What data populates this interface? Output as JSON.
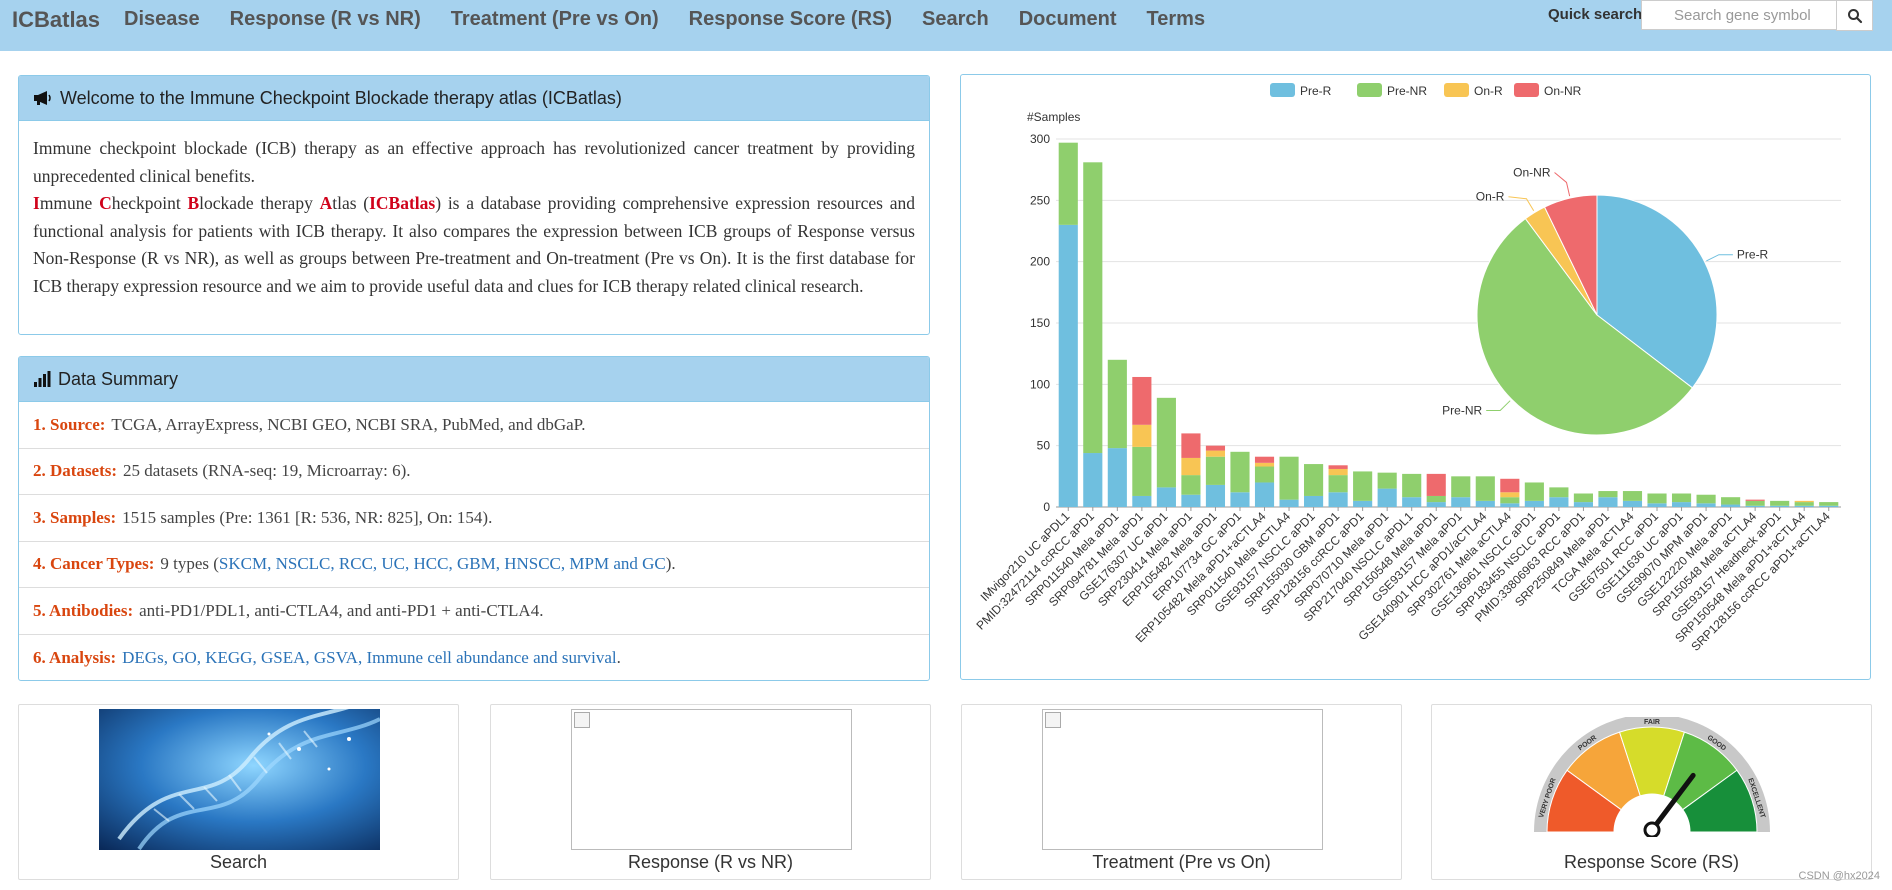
{
  "navbar": {
    "brand": "ICBatlas",
    "items": [
      {
        "label": "Disease"
      },
      {
        "label": "Response (R vs NR)"
      },
      {
        "label": "Treatment (Pre vs On)"
      },
      {
        "label": "Response Score (RS)"
      },
      {
        "label": "Search"
      },
      {
        "label": "Document"
      },
      {
        "label": "Terms"
      }
    ],
    "quick_search_label": "Quick search",
    "search_placeholder": "Search gene symbol",
    "search_button_icon": "search-icon"
  },
  "welcome": {
    "icon": "megaphone-icon",
    "title": "Welcome to the Immune Checkpoint Blockade therapy atlas (ICBatlas)",
    "para1": "Immune checkpoint blockade (ICB) therapy as an effective approach has revolutionized cancer treatment by providing unprecedented clinical benefits.",
    "acr": [
      {
        "letter": "I",
        "rest": "mmune "
      },
      {
        "letter": "C",
        "rest": "heckpoint "
      },
      {
        "letter": "B",
        "rest": "lockade therapy "
      },
      {
        "letter": "A",
        "rest": "tlas ("
      }
    ],
    "acr_name": "ICBatlas",
    "para2_rest": ") is a database providing comprehensive expression resources and functional analysis for patients with ICB therapy. It also compares the expression between ICB groups of Response versus Non-Response (R vs NR), as well as groups between Pre-treatment and On-treatment (Pre vs On). It is the first database for ICB therapy expression resource and we aim to provide useful data and clues for ICB therapy related clinical research."
  },
  "summary": {
    "icon": "bar-chart-icon",
    "title": "Data Summary",
    "rows": [
      {
        "label": "1. Source:",
        "text": "TCGA, ArrayExpress, NCBI GEO, NCBI SRA, PubMed, and dbGaP.",
        "suffix": ""
      },
      {
        "label": "2. Datasets:",
        "text": "25 datasets (RNA-seq: 19, Microarray: 6).",
        "suffix": ""
      },
      {
        "label": "3. Samples:",
        "text": "1515 samples (Pre: 1361 [R: 536, NR: 825], On: 154).",
        "suffix": ""
      },
      {
        "label": "4. Cancer Types:",
        "text": "9 types (",
        "link": "SKCM, NSCLC, RCC, UC, HCC, GBM, HNSCC, MPM and GC",
        "suffix": ")."
      },
      {
        "label": "5. Antibodies:",
        "text": "anti-PD1/PDL1, anti-CTLA4, and anti-PD1 + anti-CTLA4.",
        "suffix": ""
      },
      {
        "label": "6. Analysis:",
        "text": "",
        "link": "DEGs, GO, KEGG, GSEA, GSVA, Immune cell abundance and survival",
        "suffix": "."
      }
    ]
  },
  "chart_data": [
    {
      "type": "bar",
      "stacked": true,
      "ylabel": "#Samples",
      "ylim": [
        0,
        300
      ],
      "yticks": [
        0,
        50,
        100,
        150,
        200,
        250,
        300
      ],
      "grid": true,
      "legend_position": "top-center",
      "categories": [
        "IMvigor210 UC aPDL1",
        "PMID:32472114 ccRCC aPD1",
        "SRP011540 Mela aPD1",
        "SRP094781 Mela aPD1",
        "GSE176307 UC aPD1",
        "SRP230414 Mela aPD1",
        "ERP105482 Mela aPD1",
        "ERP107734 GC aPD1",
        "ERP105482 Mela aPD1+aCTLA4",
        "SRP011540 Mela aCTLA4",
        "GSE93157 NSCLC aPD1",
        "SRP155030 GBM aPD1",
        "SRP128156 ccRCC aPD1",
        "SRP070710 Mela aPD1",
        "SRP217040 NSCLC aPDL1",
        "SRP150548 Mela aPD1",
        "GSE93157 Mela aPD1",
        "GSE140901 HCC aPD1/aCTLA4",
        "SRP302761 Mela aCTLA4",
        "GSE136961 NSCLC aPD1",
        "SRP183455 NSCLC aPD1",
        "PMID:33806963 RCC aPD1",
        "SRP250849 Mela aPD1",
        "TCGA Mela aCTLA4",
        "GSE67501 RCC aPD1",
        "GSE111636 UC aPD1",
        "GSE99070 MPM aPD1",
        "GSE122220 Mela aPD1",
        "SRP150548 Mela aCTLA4",
        "GSE93157 Headneck aPD1",
        "SRP150548 Mela aPD1+aCTLA4",
        "SRP128156 ccRCC aPD1+aCTLA4"
      ],
      "series": [
        {
          "name": "Pre-R",
          "color": "#6fbfdf",
          "values": [
            230,
            44,
            48,
            9,
            16,
            10,
            18,
            12,
            20,
            6,
            9,
            12,
            5,
            15,
            8,
            4,
            8,
            5,
            3,
            5,
            8,
            4,
            8,
            5,
            3,
            4,
            3,
            2,
            1,
            1,
            1,
            1
          ]
        },
        {
          "name": "Pre-NR",
          "color": "#8fcf6d",
          "values": [
            67,
            237,
            72,
            40,
            73,
            16,
            23,
            33,
            13,
            35,
            26,
            14,
            24,
            13,
            19,
            5,
            17,
            20,
            5,
            15,
            8,
            7,
            5,
            8,
            8,
            7,
            7,
            6,
            4,
            4,
            3,
            3
          ]
        },
        {
          "name": "On-R",
          "color": "#f8c554",
          "values": [
            0,
            0,
            0,
            18,
            0,
            14,
            5,
            0,
            3,
            0,
            0,
            5,
            0,
            0,
            0,
            0,
            0,
            0,
            4,
            0,
            0,
            0,
            0,
            0,
            0,
            0,
            0,
            0,
            0,
            0,
            1,
            0
          ]
        },
        {
          "name": "On-NR",
          "color": "#ee6a6d",
          "values": [
            0,
            0,
            0,
            39,
            0,
            20,
            4,
            0,
            5,
            0,
            0,
            3,
            0,
            0,
            0,
            18,
            0,
            0,
            11,
            0,
            0,
            0,
            0,
            0,
            0,
            0,
            0,
            0,
            1,
            0,
            0,
            0
          ]
        }
      ]
    },
    {
      "type": "pie",
      "slices": [
        {
          "name": "Pre-R",
          "value": 536,
          "color": "#6fbfdf"
        },
        {
          "name": "Pre-NR",
          "value": 825,
          "color": "#8fcf6d"
        },
        {
          "name": "On-R",
          "value": 45,
          "color": "#f8c554"
        },
        {
          "name": "On-NR",
          "value": 109,
          "color": "#ee6a6d"
        }
      ]
    }
  ],
  "cards": [
    {
      "label": "Search"
    },
    {
      "label": "Response (R vs NR)"
    },
    {
      "label": "Treatment (Pre vs On)"
    },
    {
      "label": "Response Score (RS)"
    }
  ],
  "gauge": {
    "labels": [
      "VERY POOR",
      "POOR",
      "FAIR",
      "GOOD",
      "EXCELLENT"
    ]
  },
  "watermark": "CSDN @hx2024"
}
